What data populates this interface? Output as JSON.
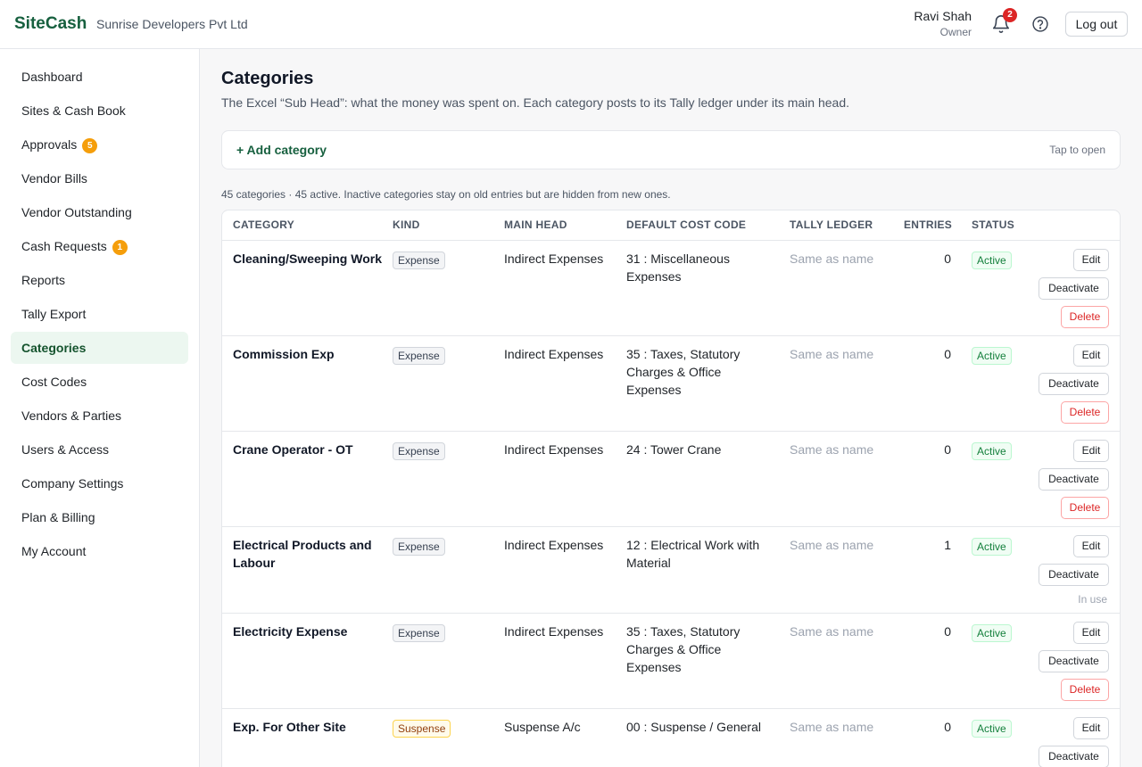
{
  "header": {
    "brand": "SiteCash",
    "company": "Sunrise Developers Pvt Ltd",
    "user_name": "Ravi Shah",
    "user_role": "Owner",
    "notification_count": "2",
    "logout_label": "Log out"
  },
  "sidebar": {
    "items": [
      {
        "label": "Dashboard",
        "badge": ""
      },
      {
        "label": "Sites & Cash Book",
        "badge": ""
      },
      {
        "label": "Approvals",
        "badge": "5"
      },
      {
        "label": "Vendor Bills",
        "badge": ""
      },
      {
        "label": "Vendor Outstanding",
        "badge": ""
      },
      {
        "label": "Cash Requests",
        "badge": "1"
      },
      {
        "label": "Reports",
        "badge": ""
      },
      {
        "label": "Tally Export",
        "badge": ""
      },
      {
        "label": "Categories",
        "badge": "",
        "active": true
      },
      {
        "label": "Cost Codes",
        "badge": ""
      },
      {
        "label": "Vendors & Parties",
        "badge": ""
      },
      {
        "label": "Users & Access",
        "badge": ""
      },
      {
        "label": "Company Settings",
        "badge": ""
      },
      {
        "label": "Plan & Billing",
        "badge": ""
      },
      {
        "label": "My Account",
        "badge": ""
      }
    ]
  },
  "main": {
    "title": "Categories",
    "subtitle": "The Excel “Sub Head”: what the money was spent on. Each category posts to its Tally ledger under its main head.",
    "add_label": "+ Add category",
    "add_hint": "Tap to open",
    "summary": "45 categories · 45 active. Inactive categories stay on old entries but are hidden from new ones."
  },
  "table": {
    "headers": {
      "category": "CATEGORY",
      "kind": "KIND",
      "main_head": "MAIN HEAD",
      "cost_code": "DEFAULT COST CODE",
      "ledger": "TALLY LEDGER",
      "entries": "ENTRIES",
      "status": "STATUS"
    },
    "actions": {
      "edit": "Edit",
      "deactivate": "Deactivate",
      "delete": "Delete",
      "in_use": "In use"
    },
    "rows": [
      {
        "name": "Cleaning/Sweeping Work",
        "kind": "Expense",
        "main_head": "Indirect Expenses",
        "cost_code": "31 : Miscellaneous Expenses",
        "ledger": "Same as name",
        "entries": "0",
        "status": "Active",
        "in_use": false
      },
      {
        "name": "Commission Exp",
        "kind": "Expense",
        "main_head": "Indirect Expenses",
        "cost_code": "35 : Taxes, Statutory Charges & Office Expenses",
        "ledger": "Same as name",
        "entries": "0",
        "status": "Active",
        "in_use": false
      },
      {
        "name": "Crane Operator - OT",
        "kind": "Expense",
        "main_head": "Indirect Expenses",
        "cost_code": "24 : Tower Crane",
        "ledger": "Same as name",
        "entries": "0",
        "status": "Active",
        "in_use": false
      },
      {
        "name": "Electrical Products and Labour",
        "kind": "Expense",
        "main_head": "Indirect Expenses",
        "cost_code": "12 : Electrical Work with Material",
        "ledger": "Same as name",
        "entries": "1",
        "status": "Active",
        "in_use": true
      },
      {
        "name": "Electricity Expense",
        "kind": "Expense",
        "main_head": "Indirect Expenses",
        "cost_code": "35 : Taxes, Statutory Charges & Office Expenses",
        "ledger": "Same as name",
        "entries": "0",
        "status": "Active",
        "in_use": false
      },
      {
        "name": "Exp. For Other Site",
        "kind": "Suspense",
        "main_head": "Suspense A/c",
        "cost_code": "00 : Suspense / General",
        "ledger": "Same as name",
        "entries": "0",
        "status": "Active",
        "in_use": false
      }
    ]
  },
  "colors": {
    "brand": "#17603f",
    "active_nav_bg": "#ecf7f0",
    "badge_orange": "#f59e0b",
    "notification_red": "#dc2626",
    "status_green": "#15803d",
    "delete_red": "#dc2626"
  },
  "icons": {
    "bell": "bell-icon",
    "help": "help-circle-icon"
  }
}
